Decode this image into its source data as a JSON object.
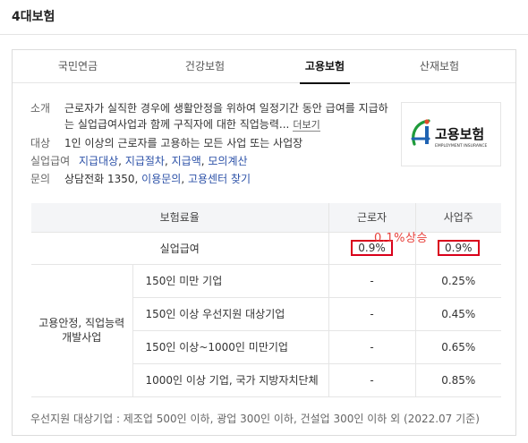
{
  "section": {
    "title": "4대보험"
  },
  "tabs": [
    {
      "label": "국민연금"
    },
    {
      "label": "건강보험"
    },
    {
      "label": "고용보험"
    },
    {
      "label": "산재보험"
    }
  ],
  "info": {
    "intro_label": "소개",
    "intro_text": "근로자가 실직한 경우에 생활안정을 위하여 일정기간 동안 급여를 지급하는 실업급여사업과 함께 구직자에 대한 직업능력...",
    "more_label": "더보기",
    "target_label": "대상",
    "target_text": "1인 이상의 근로자를 고용하는 모든 사업 또는 사업장",
    "unemp_label": "실업급여",
    "unemp_links": [
      "지급대상",
      "지급절차",
      "지급액",
      "모의계산"
    ],
    "contact_label": "문의",
    "contact_text": "상담전화 1350",
    "contact_links": [
      "이용문의",
      "고용센터 찾기"
    ]
  },
  "logo": {
    "text": "고용보험",
    "sub": "EMPLOYMENT INSURANCE"
  },
  "table": {
    "headers": [
      "보험료율",
      "근로자",
      "사업주"
    ],
    "unemployment": {
      "label": "실업급여",
      "worker": "0.9%",
      "employer": "0.9%"
    },
    "group_label": "고용안정, 직업능력 개발사업",
    "rows": [
      {
        "label": "150인 미만 기업",
        "worker": "-",
        "employer": "0.25%"
      },
      {
        "label": "150인 이상 우선지원 대상기업",
        "worker": "-",
        "employer": "0.45%"
      },
      {
        "label": "150인 이상~1000인 미만기업",
        "worker": "-",
        "employer": "0.65%"
      },
      {
        "label": "1000인 이상 기업, 국가 지방자치단체",
        "worker": "-",
        "employer": "0.85%"
      }
    ]
  },
  "annotation": "0.1%상승",
  "footer_note": "우선지원 대상기업 : 제조업 500인 이하, 광업 300인 이하, 건설업 300인 이하 외 (2022.07 기준)",
  "colors": {
    "highlight": "#d9001b",
    "annotation": "#e8423c",
    "link": "#2d52a8"
  }
}
